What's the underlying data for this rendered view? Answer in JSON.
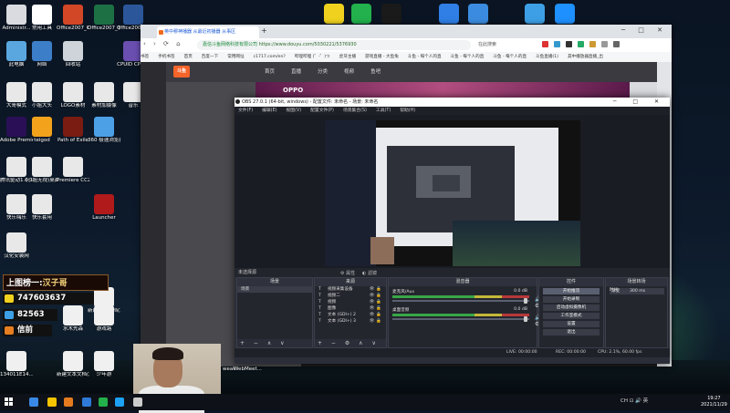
{
  "desktop": {
    "icons": [
      {
        "label": "Administr...",
        "color": "#d9dbe0"
      },
      {
        "label": "常用工具",
        "color": "#ffffff"
      },
      {
        "label": "Office2007_C3打开PPT",
        "color": "#d24726"
      },
      {
        "label": "Office2007_表格",
        "color": "#1d7044"
      },
      {
        "label": "Office2007_文字",
        "color": "#2b579a"
      },
      {
        "label": "此电脑",
        "color": "#5aa7e0"
      },
      {
        "label": "网络",
        "color": "#3d7ec8"
      },
      {
        "label": "回收站",
        "color": "#cfd4da"
      },
      {
        "label": "CPUID CPU-Z",
        "color": "#6a4fb0"
      },
      {
        "label": "大哥模式",
        "color": "#e8e8e8"
      },
      {
        "label": "小姐大头",
        "color": "#e8e8e8"
      },
      {
        "label": "LOGO素材",
        "color": "#e8e8e8"
      },
      {
        "label": "素材加摄像",
        "color": "#e8e8e8"
      },
      {
        "label": "音乐",
        "color": "#e8e8e8"
      },
      {
        "label": "Adobe Premie...",
        "color": "#2a0f56"
      },
      {
        "label": "teigod",
        "color": "#f3a21c"
      },
      {
        "label": "Path of Exile",
        "color": "#7a1c12"
      },
      {
        "label": "360 极速浏览器X",
        "color": "#4ca0e6"
      },
      {
        "label": "腾讯驱动1.0.1",
        "color": "#e8e8e8"
      },
      {
        "label": "(小姐无视)桌面模板",
        "color": "#e8e8e8"
      },
      {
        "label": "Premiere CC2018",
        "color": "#e8e8e8"
      },
      {
        "label": "快乐嗨乐",
        "color": "#e8e8e8"
      },
      {
        "label": "快乐套用",
        "color": "#e8e8e8"
      },
      {
        "label": "Launcher",
        "color": "#b01a1a"
      },
      {
        "label": "汉化安装网",
        "color": "#e8e8e8"
      },
      {
        "label": "新建文本文档(3)",
        "color": "#f0f0f0"
      },
      {
        "label": "水木先森",
        "color": "#f0f0f0"
      },
      {
        "label": "游戏路",
        "color": "#f0f0f0"
      },
      {
        "label": "134011E14...",
        "color": "#f0f0f0"
      },
      {
        "label": "新建文本文档(2)",
        "color": "#f0f0f0"
      },
      {
        "label": "少年游",
        "color": "#f0f0f0"
      }
    ],
    "top_tray_colors": [
      "#f0d21e",
      "#22b14c",
      "#1a1a1a",
      "#2f7fe6",
      "#3b8ce0",
      "#3da0e6",
      "#1e90ff"
    ],
    "top_tray_names": [
      "yellow-app-icon",
      "wechat-icon",
      "qq-icon",
      "k-app-icon",
      "mountain-app-icon",
      "search-app-icon",
      "feishu-icon"
    ],
    "bottom_text": [
      "weak",
      "WebMeet..."
    ]
  },
  "browser": {
    "tab_title": "英中穆神播器 从最近初播器 从事区",
    "new_tab": "+",
    "url_secure": "嘉信斗鱼网络科技有限公司",
    "url_path": "https://www.douyu.com/5030221/5376930",
    "search_placeholder": "在此搜索",
    "bookmarks": [
      "书签",
      "手机书签",
      "首页",
      "百度一下",
      "常用网址",
      "c1717.com/en?",
      "哔哩哔哩 (゜-゜)つ",
      "虎牙主播",
      "游戏直播 - 大鱼兔",
      "斗鱼 - 每个人的直",
      "斗鱼 - 每个人的直",
      "斗鱼 - 每个人的直",
      "斗鱼直播(1)",
      "其中播放器直播_出"
    ],
    "site_logo": "斗鱼",
    "site_nav": [
      "首页",
      "直播",
      "分类",
      "视频",
      "鱼吧"
    ],
    "banner_text": "OPPO"
  },
  "obs": {
    "title": "OBS 27.0.1 (64-bit, windows) - 配置文件: 未命名 - 场景: 未命名",
    "menu": [
      "文件(F)",
      "编辑(E)",
      "视图(V)",
      "配置文件(P)",
      "场景集合(S)",
      "工具(T)",
      "帮助(H)"
    ],
    "selected_source": "未选择源",
    "properties_btn": "属性",
    "filters_btn": "滤镜",
    "panels": {
      "scenes": "场景",
      "sources": "来源",
      "mixer": "混音器",
      "transitions": "场景转场",
      "controls": "控件"
    },
    "scene_items": [
      "场景"
    ],
    "sources": [
      {
        "type": "T",
        "name": "视频采集设备"
      },
      {
        "type": "T",
        "name": "视频二"
      },
      {
        "type": "T",
        "name": "视频"
      },
      {
        "type": "T",
        "name": "图像"
      },
      {
        "type": "T",
        "name": "文本 (GDI+) 2"
      },
      {
        "type": "T",
        "name": "文本 (GDI+) 3"
      }
    ],
    "mixer": [
      {
        "name": "麦克风/Aux",
        "db": "0.0 dB",
        "level": 0.6
      },
      {
        "name": "桌面音频",
        "db": "0.0 dB",
        "level": 0.6
      }
    ],
    "controls": [
      "开始推流",
      "开始录制",
      "启动虚拟摄像机",
      "工作室模式",
      "设置",
      "退出"
    ],
    "active_control": "开始推流",
    "transition": {
      "label": "",
      "value": "渐变",
      "duration_label": "时长",
      "duration_value": "300 ms"
    },
    "status": {
      "live": "LIVE: 00:00:00",
      "rec": "REC: 00:00:00",
      "cpu": "CPU: 2.1%, 60.00 fps"
    }
  },
  "overlay": {
    "banner_prefix": "上图榜一:",
    "banner_name": "汉子哥",
    "row1": "747603637",
    "row2": "82563",
    "row3": "信前"
  },
  "taskbar": {
    "icons": [
      "#3a88e5",
      "#f5c400",
      "#e57b1e",
      "#2f7ad8",
      "#23b04a",
      "#1da1f2",
      "#cccccc"
    ],
    "icon_names": [
      "file-explorer-icon",
      "folder-icon",
      "browser-icon",
      "ie-icon",
      "green-app-icon",
      "twitter-app-icon",
      "obs-icon"
    ],
    "tray": "CH ⊡ 🔊 英",
    "time": "19:27",
    "date": "2021/11/29"
  }
}
